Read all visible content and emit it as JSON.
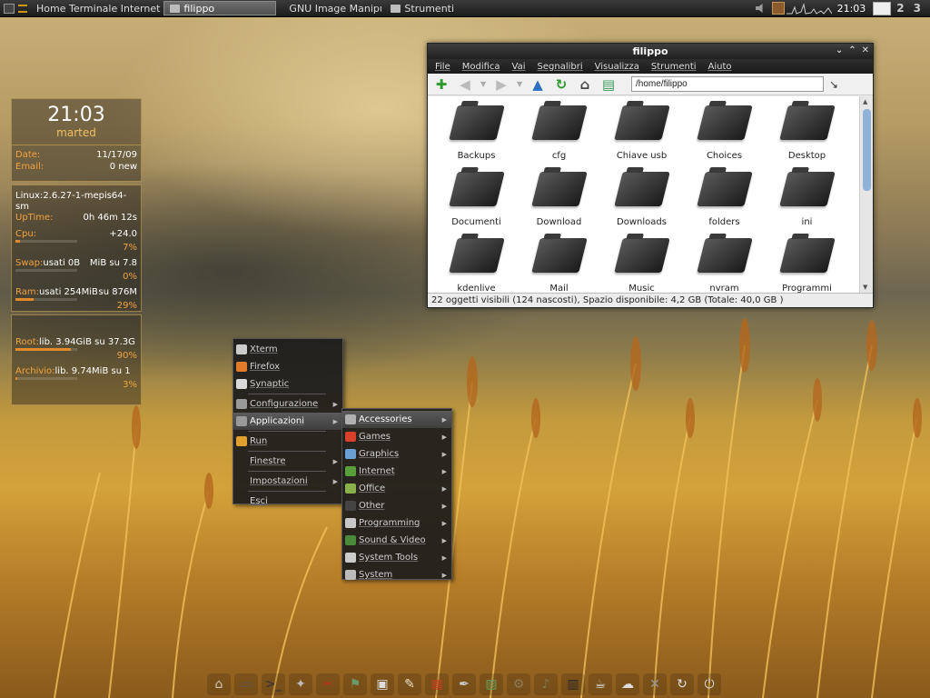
{
  "topbar": {
    "launchers": "Home Terminale Internet",
    "tasks": [
      {
        "label": "filippo",
        "active": true
      },
      {
        "label": "GNU Image Manipul...",
        "active": false
      },
      {
        "label": "Strumenti",
        "active": false
      }
    ],
    "clock": "21:03",
    "workspaces": [
      "2",
      "3"
    ]
  },
  "conky": {
    "time": "21:03",
    "day": "marted",
    "date_label": "Date:",
    "date_value": "11/17/09",
    "email_label": "Email:",
    "email_value": "0 new",
    "kernel": "Linux:2.6.27-1-mepis64-sm",
    "uptime_label": "UpTime:",
    "uptime_value": "0h 46m 12s",
    "cpu_label": "Cpu:",
    "cpu_value": "+24.0",
    "cpu_pct": "7%",
    "cpu_level": 0.07,
    "swap_label": "Swap:",
    "swap_value": "usati 0B",
    "swap_total": "MiB su 7.8",
    "swap_pct": "0%",
    "swap_level": 0.0,
    "ram_label": "Ram:",
    "ram_value": "usati 254MiB",
    "ram_total": "su 876M",
    "ram_pct": "29%",
    "ram_level": 0.29,
    "root_label": "Root:",
    "root_value": "lib. 3.94GiB su 37.3G",
    "root_pct": "90%",
    "root_level": 0.9,
    "archivio_label": "Archivio:",
    "archivio_value": "lib. 9.74MiB su 1",
    "archivio_pct": "3%",
    "archivio_level": 0.03
  },
  "filemanager": {
    "title": "filippo",
    "menu": [
      "File",
      "Modifica",
      "Vai",
      "Segnalibri",
      "Visualizza",
      "Strumenti",
      "Aiuto"
    ],
    "path": "/home/filippo",
    "folders": [
      "Backups",
      "cfg",
      "Chiave usb",
      "Choices",
      "Desktop",
      "Documenti",
      "Download",
      "Downloads",
      "folders",
      "ini",
      "kdenlive",
      "Mail",
      "Music",
      "nvram",
      "Programmi"
    ],
    "status": "22 oggetti visibili (124 nascosti), Spazio disponibile: 4,2 GB (Totale: 40,0 GB )"
  },
  "menu_main": [
    {
      "label": "Xterm",
      "submenu": false,
      "icon_color": "#cccccc"
    },
    {
      "label": "Firefox",
      "submenu": false,
      "icon_color": "#e07b2a"
    },
    {
      "label": "Synaptic",
      "submenu": false,
      "icon_color": "#d9d9d9"
    },
    {
      "label": "Configurazione",
      "submenu": true,
      "icon_color": "#999999"
    },
    {
      "label": "Applicazioni",
      "submenu": true,
      "icon_color": "#999999",
      "highlighted": true
    },
    {
      "label": "Run",
      "submenu": false,
      "icon_color": "#e0a030"
    },
    {
      "label": "Finestre",
      "submenu": true,
      "icon_color": ""
    },
    {
      "label": "Impostazioni",
      "submenu": true,
      "icon_color": ""
    },
    {
      "label": "Esci",
      "submenu": false,
      "icon_color": ""
    }
  ],
  "menu_apps": [
    {
      "label": "Accessories",
      "icon_color": "#b0b0b0",
      "highlighted": true
    },
    {
      "label": "Games",
      "icon_color": "#d9402a"
    },
    {
      "label": "Graphics",
      "icon_color": "#6a9fd4"
    },
    {
      "label": "Internet",
      "icon_color": "#5aa03a"
    },
    {
      "label": "Office",
      "icon_color": "#8ab04a"
    },
    {
      "label": "Other",
      "icon_color": "#444444"
    },
    {
      "label": "Programming",
      "icon_color": "#c8c8c8"
    },
    {
      "label": "Sound & Video",
      "icon_color": "#4a8a3a"
    },
    {
      "label": "System Tools",
      "icon_color": "#cccccc"
    },
    {
      "label": "System",
      "icon_color": "#bbbbbb"
    }
  ],
  "dock": [
    {
      "icon": "home-icon",
      "glyph": "⌂",
      "color": "#cfc8b8"
    },
    {
      "icon": "panel-icon",
      "glyph": "▭",
      "color": "#555555"
    },
    {
      "icon": "terminal-icon",
      "glyph": ">_",
      "color": "#333333"
    },
    {
      "icon": "gamepad-icon",
      "glyph": "✦",
      "color": "#bbbbbb"
    },
    {
      "icon": "tools-icon",
      "glyph": "✂",
      "color": "#c0301e"
    },
    {
      "icon": "network-icon",
      "glyph": "⚑",
      "color": "#6a9a6a"
    },
    {
      "icon": "monitor-icon",
      "glyph": "▣",
      "color": "#dddddd"
    },
    {
      "icon": "notes-icon",
      "glyph": "✎",
      "color": "#e8e2c8"
    },
    {
      "icon": "office-icon",
      "glyph": "▦",
      "color": "#c0401e"
    },
    {
      "icon": "pen-icon",
      "glyph": "✒",
      "color": "#cccccc"
    },
    {
      "icon": "image-icon",
      "glyph": "▨",
      "color": "#6a9a5a"
    },
    {
      "icon": "settings-icon",
      "glyph": "⚙",
      "color": "#8a7a5a"
    },
    {
      "icon": "speaker-icon",
      "glyph": "♪",
      "color": "#7a7a5a"
    },
    {
      "icon": "film-icon",
      "glyph": "▥",
      "color": "#2a2a2a"
    },
    {
      "icon": "cup-icon",
      "glyph": "☕",
      "color": "#dddddd"
    },
    {
      "icon": "cloud-icon",
      "glyph": "☁",
      "color": "#dddddd"
    },
    {
      "icon": "wrench-icon",
      "glyph": "✕",
      "color": "#999999"
    },
    {
      "icon": "refresh-icon",
      "glyph": "↻",
      "color": "#e0e0e0"
    },
    {
      "icon": "power-icon",
      "glyph": "⏻",
      "color": "#d6d6d6"
    }
  ]
}
